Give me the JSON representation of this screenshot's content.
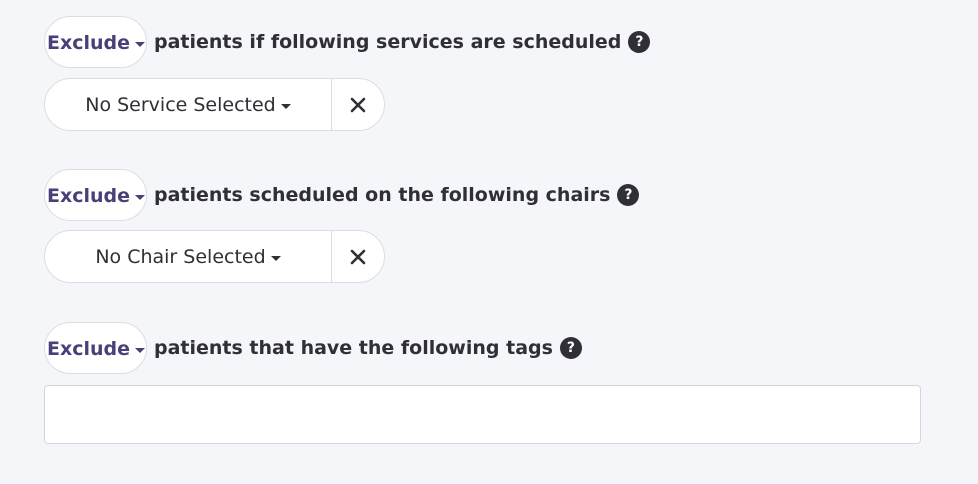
{
  "rules": [
    {
      "mode": "Exclude",
      "text": "patients if following services are scheduled",
      "help": "?",
      "select": "No Service Selected"
    },
    {
      "mode": "Exclude",
      "text": "patients scheduled on the following chairs",
      "help": "?",
      "select": "No Chair Selected"
    },
    {
      "mode": "Exclude",
      "text": "patients that have the following tags",
      "help": "?",
      "tags_value": ""
    }
  ],
  "icons": {
    "caret": "chevron-down-icon",
    "clear": "close-icon",
    "help": "help-icon"
  },
  "colors": {
    "background": "#f5f6fa",
    "mode_text": "#4a3f78",
    "body_text": "#2f2f35",
    "border": "#dcdde4"
  }
}
